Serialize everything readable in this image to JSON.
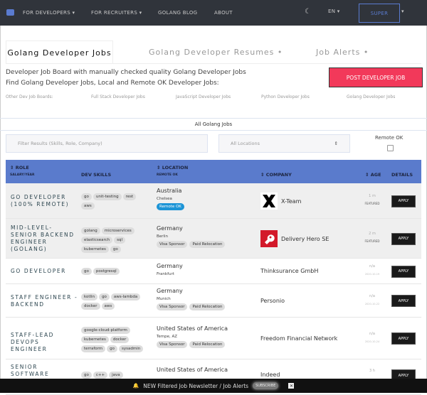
{
  "nav": {
    "items": [
      "FOR DEVELOPERS ▾",
      "FOR RECRUITERS ▾",
      "GOLANG BLOG",
      "ABOUT"
    ],
    "lang": "EN ▾",
    "user": "SUPER",
    "caret": "▾",
    "moon": "☾"
  },
  "tabs": [
    "Golang Developer Jobs",
    "Golang Developer Resumes  •",
    "Job Alerts  •"
  ],
  "intro": [
    "Developer Job Board with manually checked quality Golang Developer Jobs",
    "Find Golang Developer Jobs, Local and Remote OK Developer Jobs:"
  ],
  "post_label": "POST DEVELOPER JOB",
  "boards": [
    "Other Dev Job Boards:",
    "Full Stack Developer Jobs",
    "JavaScript Developer Jobs",
    "Python Developer Jobs",
    "Golang Developer Jobs"
  ],
  "all_jobs": "All Golang Jobs",
  "filter": {
    "placeholder": "Filter Results (Skills, Role, Company)",
    "location": "All Locations",
    "remote_label": "Remote OK"
  },
  "table": {
    "role": "⇕ ROLE",
    "salary": "SALARY/YEAR",
    "skills": "DEV SKILLS",
    "location": "⇕ LOCATION",
    "remote": "REMOTE OK",
    "company": "⇕ COMPANY",
    "age": "⇕ AGE",
    "details": "DETAILS"
  },
  "apply": "APPLY",
  "jobs": [
    {
      "role": "GO DEVELOPER (100% REMOTE)",
      "skills": [
        "go",
        "unit-testing",
        "rest",
        "aws"
      ],
      "country": "Australia",
      "city": "Chelsea",
      "badges": [
        "Remote OK"
      ],
      "company": "X-Team",
      "age": "1 m",
      "sub": "FEATURED"
    },
    {
      "role": "MID-LEVEL-SENIOR BACKEND ENGINEER (GOLANG)",
      "skills": [
        "golang",
        "microservices",
        "elasticsearch",
        "sql",
        "kubernetes",
        "go"
      ],
      "country": "Germany",
      "city": "Berlin",
      "badges": [
        "Visa Sponsor",
        "Paid Relocation"
      ],
      "company": "Delivery Hero SE",
      "age": "2 m",
      "sub": "FEATURED"
    },
    {
      "role": "GO DEVELOPER",
      "skills": [
        "go",
        "postgresql"
      ],
      "country": "Germany",
      "city": "Frankfurt",
      "badges": [],
      "company": "Thinksurance GmbH",
      "age": "n/a",
      "date": "2020-10-19"
    },
    {
      "role": "STAFF ENGINEER - BACKEND",
      "skills": [
        "kotlin",
        "go",
        "aws-lambda",
        "docker",
        "aws"
      ],
      "country": "Germany",
      "city": "Munich",
      "badges": [
        "Visa Sponsor",
        "Paid Relocation"
      ],
      "company": "Personio",
      "age": "n/a",
      "date": "2020-10-22"
    },
    {
      "role": "STAFF-LEAD DEVOPS ENGINEER",
      "skills": [
        "google-cloud-platform",
        "kubernetes",
        "docker",
        "terraform",
        "go",
        "sysadmin"
      ],
      "country": "United States of America",
      "city": "Tempe, AZ",
      "badges": [
        "Visa Sponsor",
        "Paid Relocation"
      ],
      "company": "Freedom Financial Network",
      "age": "n/a",
      "date": "2020-10-24"
    },
    {
      "role": "SENIOR SOFTWARE ENGINEER",
      "skills": [
        "go",
        "c++",
        "java"
      ],
      "country": "United States of America",
      "city": "",
      "badges": [],
      "company": "Indeed",
      "age": "3 h"
    }
  ],
  "newsletter": {
    "bell": "🔔",
    "text": "NEW Filtered Job Newsletter / Job Alerts",
    "subscribe": "SUBSCRIBE",
    "close": "✕"
  }
}
